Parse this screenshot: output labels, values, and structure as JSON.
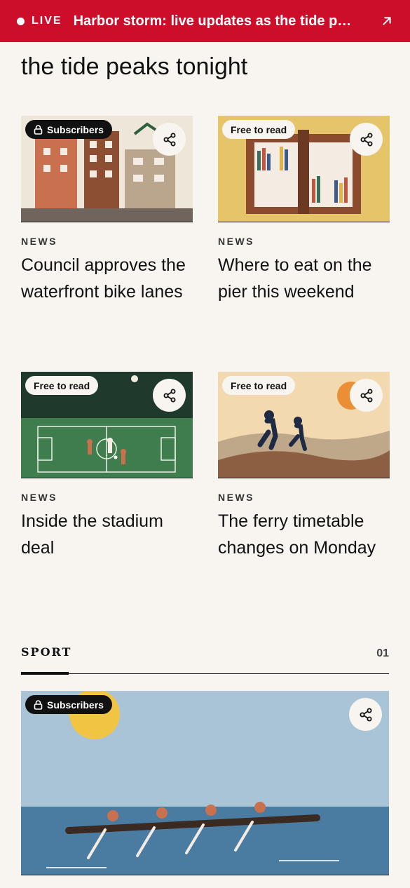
{
  "live_bar": {
    "label": "LIVE",
    "headline": "Harbor storm: live updates as the tide p…",
    "arrow_icon": "arrow-up-right-icon"
  },
  "hero": {
    "title": "the tide peaks tonight"
  },
  "cards": [
    {
      "badge": "Subscribers",
      "badge_type": "subscribers",
      "kicker": "NEWS",
      "title": "Council approves the waterfront bike lanes",
      "share_icon": "share-icon"
    },
    {
      "badge": "Free to read",
      "badge_type": "free",
      "kicker": "NEWS",
      "title": "Where to eat on the pier this weekend",
      "share_icon": "share-icon"
    },
    {
      "badge": "Free to read",
      "badge_type": "free",
      "kicker": "NEWS",
      "title": "Inside the stadium deal",
      "share_icon": "share-icon"
    },
    {
      "badge": "Free to read",
      "badge_type": "free",
      "kicker": "NEWS",
      "title": "The ferry timetable changes on Monday",
      "share_icon": "share-icon"
    }
  ],
  "section": {
    "label": "SPORT",
    "count": "01"
  },
  "feature": {
    "badge": "Subscribers",
    "share_icon": "share-icon"
  },
  "colors": {
    "live_red": "#cc0e2b",
    "page_bg": "#f8f4ef",
    "ink": "#111111"
  }
}
